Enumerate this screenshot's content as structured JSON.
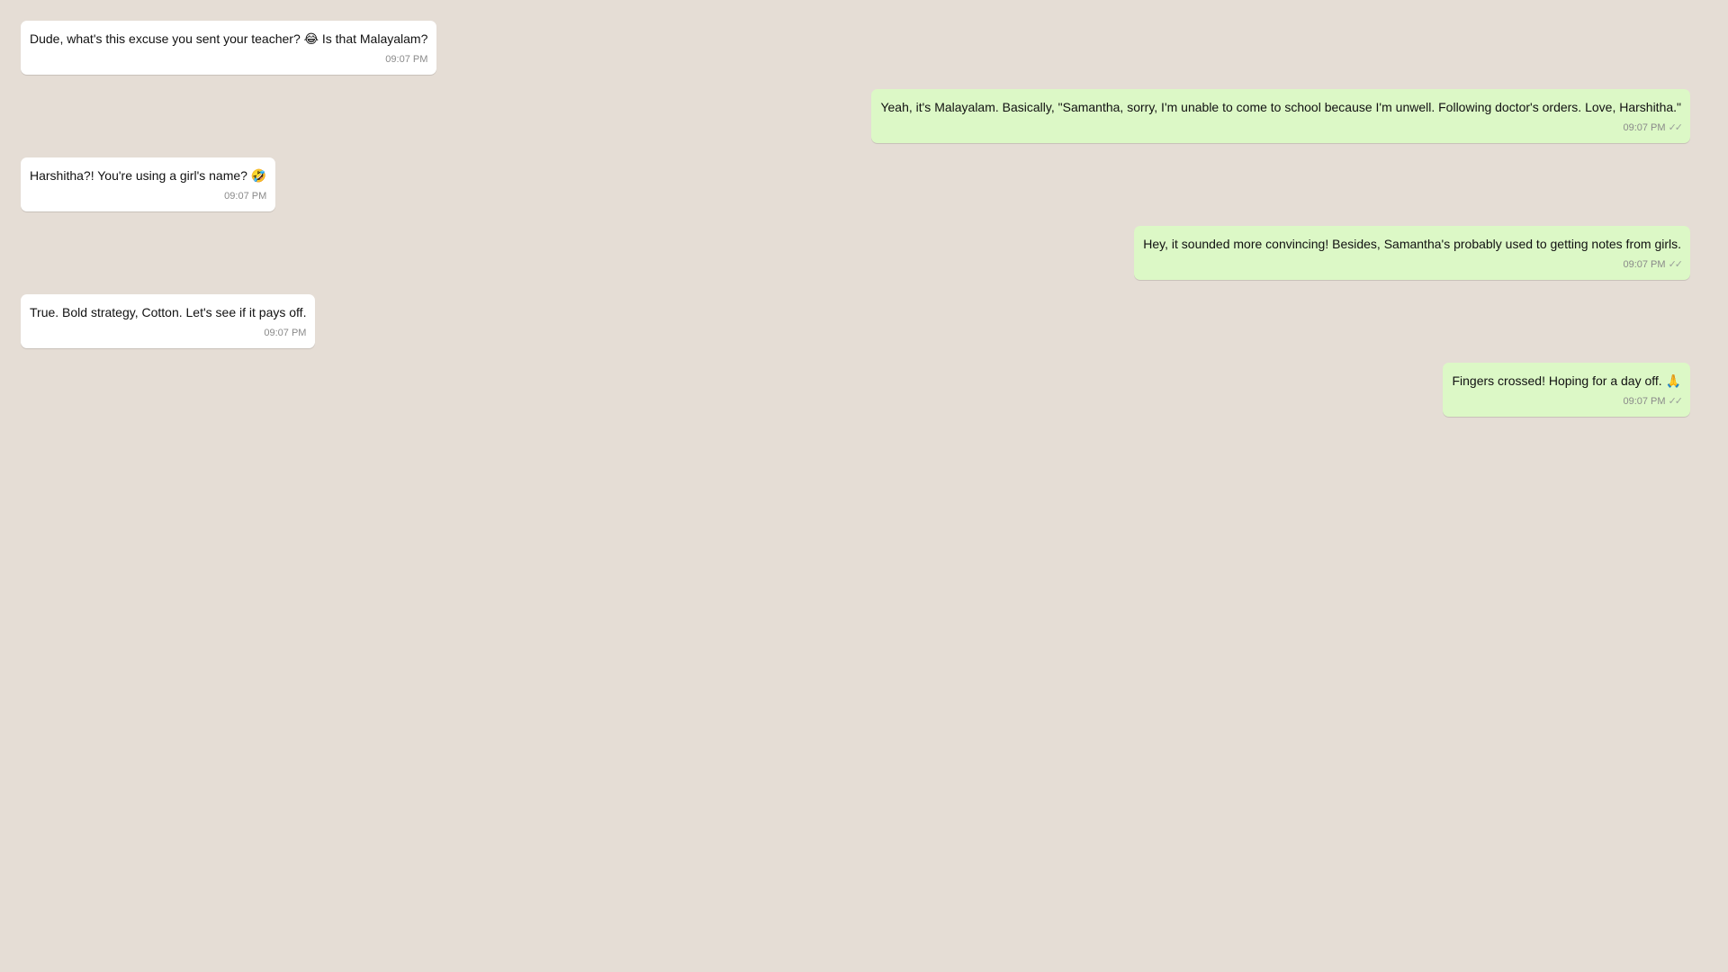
{
  "messages": [
    {
      "direction": "incoming",
      "text": "Dude, what's this excuse you sent your teacher? 😂 Is that Malayalam?",
      "time": "09:07 PM"
    },
    {
      "direction": "outgoing",
      "text": "Yeah, it's Malayalam. Basically, \"Samantha, sorry, I'm unable to come to school because I'm unwell. Following doctor's orders. Love, Harshitha.\"",
      "time": "09:07 PM",
      "status_icon": "double-check"
    },
    {
      "direction": "incoming",
      "text": "Harshitha?! You're using a girl's name? 🤣",
      "time": "09:07 PM"
    },
    {
      "direction": "outgoing",
      "text": "Hey, it sounded more convincing! Besides, Samantha's probably used to getting notes from girls.",
      "time": "09:07 PM",
      "status_icon": "double-check"
    },
    {
      "direction": "incoming",
      "text": "True. Bold strategy, Cotton. Let's see if it pays off.",
      "time": "09:07 PM"
    },
    {
      "direction": "outgoing",
      "text": "Fingers crossed! Hoping for a day off. 🙏",
      "time": "09:07 PM",
      "status_icon": "double-check"
    }
  ],
  "ticks_glyph": "✓✓",
  "colors": {
    "background": "#e5ddd5",
    "incoming_bubble": "#ffffff",
    "outgoing_bubble": "#dcf8c6",
    "meta_text": "#8a8a8a"
  }
}
